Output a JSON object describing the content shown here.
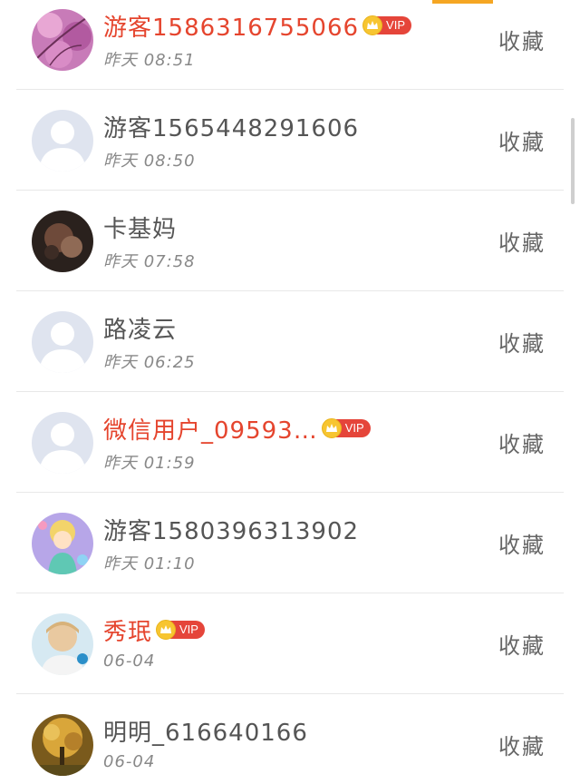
{
  "users": [
    {
      "name": "游客15863167550​66",
      "time": "昨天 08:51",
      "vip": true,
      "avatar": "avatar-pink-blossom",
      "fav": "收藏"
    },
    {
      "name": "游客1565448291606",
      "time": "昨天 08:50",
      "vip": false,
      "avatar": "avatar-default",
      "fav": "收藏"
    },
    {
      "name": "卡基妈",
      "time": "昨天 07:58",
      "vip": false,
      "avatar": "avatar-dark-photo",
      "fav": "收藏"
    },
    {
      "name": "路凌云",
      "time": "昨天 06:25",
      "vip": false,
      "avatar": "avatar-default",
      "fav": "收藏"
    },
    {
      "name": "微信用户_09593…",
      "time": "昨天 01:59",
      "vip": true,
      "avatar": "avatar-default",
      "fav": "收藏"
    },
    {
      "name": "游客1580396313902",
      "time": "昨天 01:10",
      "vip": false,
      "avatar": "avatar-cartoon",
      "fav": "收藏"
    },
    {
      "name": "秀珉",
      "time": "06-04",
      "vip": true,
      "avatar": "avatar-person-photo",
      "fav": "收藏"
    },
    {
      "name": "明明_616640166",
      "time": "06-04",
      "vip": false,
      "avatar": "avatar-autumn-tree",
      "fav": "收藏"
    }
  ],
  "vip_label": "VIP",
  "colors": {
    "accent": "#f5a623",
    "vip_name": "#e5452e",
    "vip_badge": "#e5453a",
    "crown": "#f7c531"
  }
}
